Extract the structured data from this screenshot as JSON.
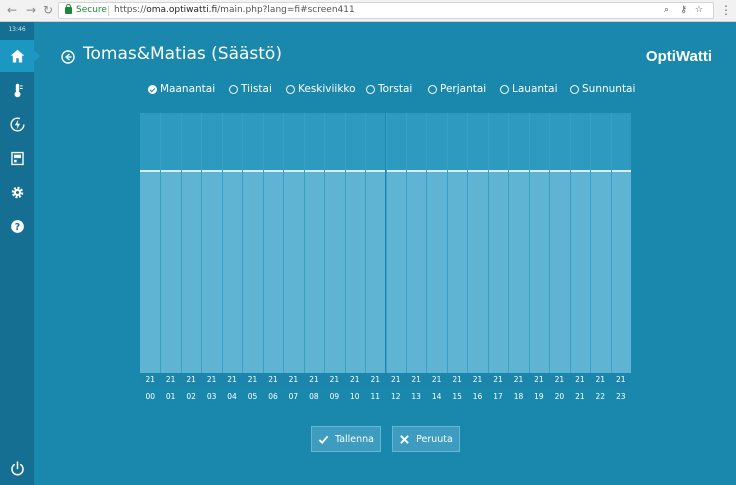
{
  "browser": {
    "secure_label": "Secure",
    "url_prefix": "https://",
    "url_host": "oma.optiwatti.fi",
    "url_rest": "/main.php?lang=fi#screen411",
    "icons": [
      "back-icon",
      "forward-icon",
      "reload-icon",
      "zoom-icon",
      "key-icon",
      "star-icon",
      "menu-icon"
    ]
  },
  "sidebar": {
    "time": "13:46",
    "items": [
      {
        "icon": "home-icon",
        "active": true
      },
      {
        "icon": "thermometer-icon",
        "active": false
      },
      {
        "icon": "energy-icon",
        "active": false
      },
      {
        "icon": "device-icon",
        "active": false
      },
      {
        "icon": "settings-icon",
        "active": false
      },
      {
        "icon": "help-icon",
        "active": false
      }
    ],
    "power_icon": "power-icon"
  },
  "header": {
    "title": "Tomas&Matias (Säästö)",
    "brand": "OptiWatti"
  },
  "days": {
    "selected": "Maanantai",
    "items": [
      "Maanantai",
      "Tiistai",
      "Keskiviikko",
      "Torstai",
      "Perjantai",
      "Lauantai",
      "Sunnuntai"
    ]
  },
  "chart_data": {
    "type": "bar",
    "categories": [
      "00",
      "01",
      "02",
      "03",
      "04",
      "05",
      "06",
      "07",
      "08",
      "09",
      "10",
      "11",
      "12",
      "13",
      "14",
      "15",
      "16",
      "17",
      "18",
      "19",
      "20",
      "21",
      "22",
      "23"
    ],
    "values": [
      21,
      21,
      21,
      21,
      21,
      21,
      21,
      21,
      21,
      21,
      21,
      21,
      21,
      21,
      21,
      21,
      21,
      21,
      21,
      21,
      21,
      21,
      21,
      21
    ],
    "value_labels": [
      "21",
      "21",
      "21",
      "21",
      "21",
      "21",
      "21",
      "21",
      "21",
      "21",
      "21",
      "21",
      "21",
      "21",
      "21",
      "21",
      "21",
      "21",
      "21",
      "21",
      "21",
      "21",
      "21",
      "21"
    ],
    "ylim": [
      0,
      26.9
    ],
    "grid": false,
    "colors": {
      "fill": "#5fb3d3",
      "background": "#2e9ac0"
    }
  },
  "buttons": {
    "save_label": "Tallenna",
    "cancel_label": "Peruuta"
  },
  "colors": {
    "background": "#1a88ad",
    "sidebar": "#146f93",
    "sidebar_active": "#1a98c2",
    "text": "#ffffff"
  }
}
